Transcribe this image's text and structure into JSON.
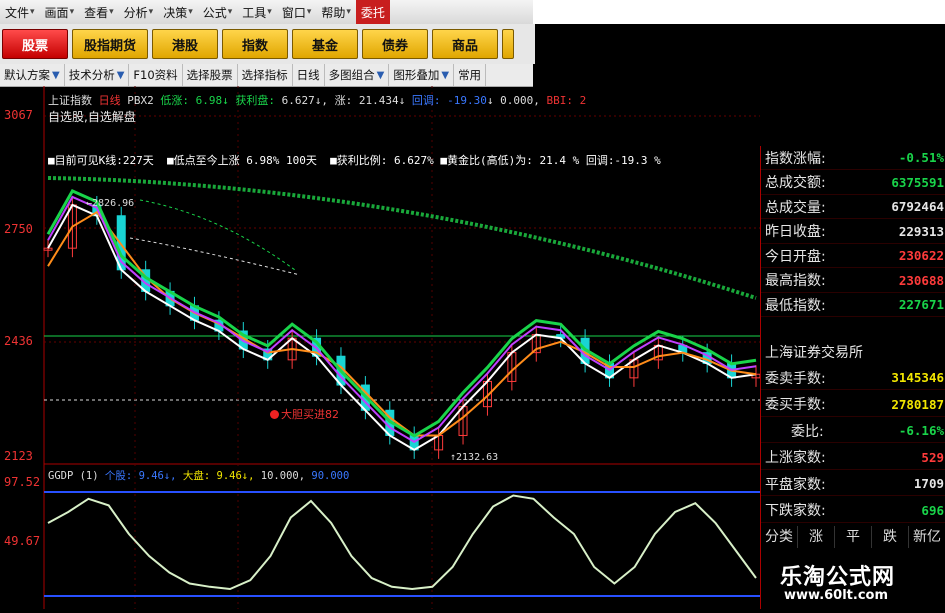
{
  "menubar": {
    "items": [
      {
        "label": "文件",
        "chev": true
      },
      {
        "label": "画面",
        "chev": true
      },
      {
        "label": "查看",
        "chev": true
      },
      {
        "label": "分析",
        "chev": true
      },
      {
        "label": "决策",
        "chev": true
      },
      {
        "label": "公式",
        "chev": true
      },
      {
        "label": "工具",
        "chev": true
      },
      {
        "label": "窗口",
        "chev": true
      },
      {
        "label": "帮助",
        "chev": true
      },
      {
        "label": "委托",
        "chev": false
      }
    ]
  },
  "market_tabs": [
    "股票",
    "股指期货",
    "港股",
    "指数",
    "基金",
    "债券",
    "商品"
  ],
  "toolbar": {
    "items": [
      "默认方案",
      "技术分析",
      "F10资料",
      "选择股票",
      "选择指标",
      "日线",
      "多图组合",
      "图形叠加",
      "常用"
    ]
  },
  "chart": {
    "info_title": {
      "name": "上证指数",
      "period": "日线",
      "formula": "PBX2",
      "low_label": "低涨",
      "low_val": "6.98",
      "profit_label": "获利盘",
      "profit_val": "6.627",
      "rise_label": "涨",
      "rise_val": "21.434",
      "dip_label": "回调",
      "dip_val": "-19.30",
      "zero_val": "0.000",
      "bbi_label": "BBI",
      "bbi_val": "2"
    },
    "sub_title": "自选股,自选解盘",
    "stats": {
      "s1": "■目前可见K线:227天",
      "s2": "■低点至今上涨 6.98%  100天",
      "s3": "■获利比例: 6.627%",
      "s4": "■黄金比(高低)为: 21.4 % 回调:-19.3 %"
    },
    "high_label": "2826.96",
    "low_label": "2132.63",
    "pick_label": "大胆买进82",
    "y_axis": [
      "3067",
      "2750",
      "2436",
      "2123"
    ],
    "chart_data": {
      "type": "line",
      "title": "上证指数 日线",
      "series": [
        {
          "name": "上证指数",
          "values": [
            2700,
            2820,
            2790,
            2640,
            2580,
            2540,
            2500,
            2470,
            2420,
            2390,
            2450,
            2400,
            2320,
            2250,
            2180,
            2140,
            2180,
            2260,
            2330,
            2410,
            2460,
            2450,
            2380,
            2340,
            2390,
            2430,
            2410,
            2380,
            2340,
            2350
          ]
        },
        {
          "name": "PBX",
          "values": [
            2650,
            2760,
            2800,
            2710,
            2620,
            2560,
            2520,
            2490,
            2450,
            2410,
            2420,
            2410,
            2370,
            2300,
            2230,
            2180,
            2180,
            2230,
            2290,
            2360,
            2420,
            2440,
            2410,
            2370,
            2370,
            2400,
            2410,
            2390,
            2360,
            2350
          ]
        }
      ],
      "ylim": [
        2123,
        3067
      ]
    }
  },
  "indicator": {
    "name": "GGDP (1)",
    "stock_label": "个股",
    "stock_val": "9.46",
    "market_label": "大盘",
    "market_val": "9.46",
    "v3": "10.000",
    "v4": "90.000",
    "y_axis": [
      "97.52",
      "49.67"
    ],
    "chart_data": {
      "type": "line",
      "series": [
        {
          "name": "GGDP",
          "values": [
            70,
            80,
            92,
            86,
            60,
            40,
            25,
            15,
            12,
            10,
            18,
            40,
            75,
            90,
            70,
            40,
            20,
            12,
            10,
            12,
            30,
            60,
            85,
            95,
            92,
            75,
            60,
            30,
            15,
            30,
            60,
            80,
            88,
            70,
            45,
            20
          ]
        }
      ],
      "ylim": [
        0,
        100
      ]
    }
  },
  "right_panel": {
    "rows": [
      {
        "label": "指数涨幅:",
        "value": "-0.51%",
        "color": "#19d44a"
      },
      {
        "label": "总成交额:",
        "value": "6375591",
        "color": "#19d44a"
      },
      {
        "label": "总成交量:",
        "value": "6792464",
        "color": "#e6e6e6"
      },
      {
        "label": "昨日收盘:",
        "value": "229313",
        "color": "#e6e6e6"
      },
      {
        "label": "今日开盘:",
        "value": "230622",
        "color": "#ff3b3b"
      },
      {
        "label": "最高指数:",
        "value": "230688",
        "color": "#ff3b3b"
      },
      {
        "label": "最低指数:",
        "value": "227671",
        "color": "#19d44a"
      }
    ],
    "section": "上海证券交易所",
    "rows2": [
      {
        "label": "委卖手数:",
        "value": "3145346",
        "color": "#f2e600"
      },
      {
        "label": "委买手数:",
        "value": "2780187",
        "color": "#f2e600"
      },
      {
        "label": "委比:",
        "value": "-6.16%",
        "color": "#19d44a"
      },
      {
        "label": "上涨家数:",
        "value": "529",
        "color": "#ff3b3b"
      },
      {
        "label": "平盘家数:",
        "value": "1709",
        "color": "#e6e6e6"
      },
      {
        "label": "下跌家数:",
        "value": "696",
        "color": "#19d44a"
      }
    ],
    "tabs": [
      "分类",
      "涨",
      "平",
      "跌",
      "新亿"
    ]
  },
  "watermark": {
    "title": "乐淘公式网",
    "url": "www.60lt.com"
  }
}
